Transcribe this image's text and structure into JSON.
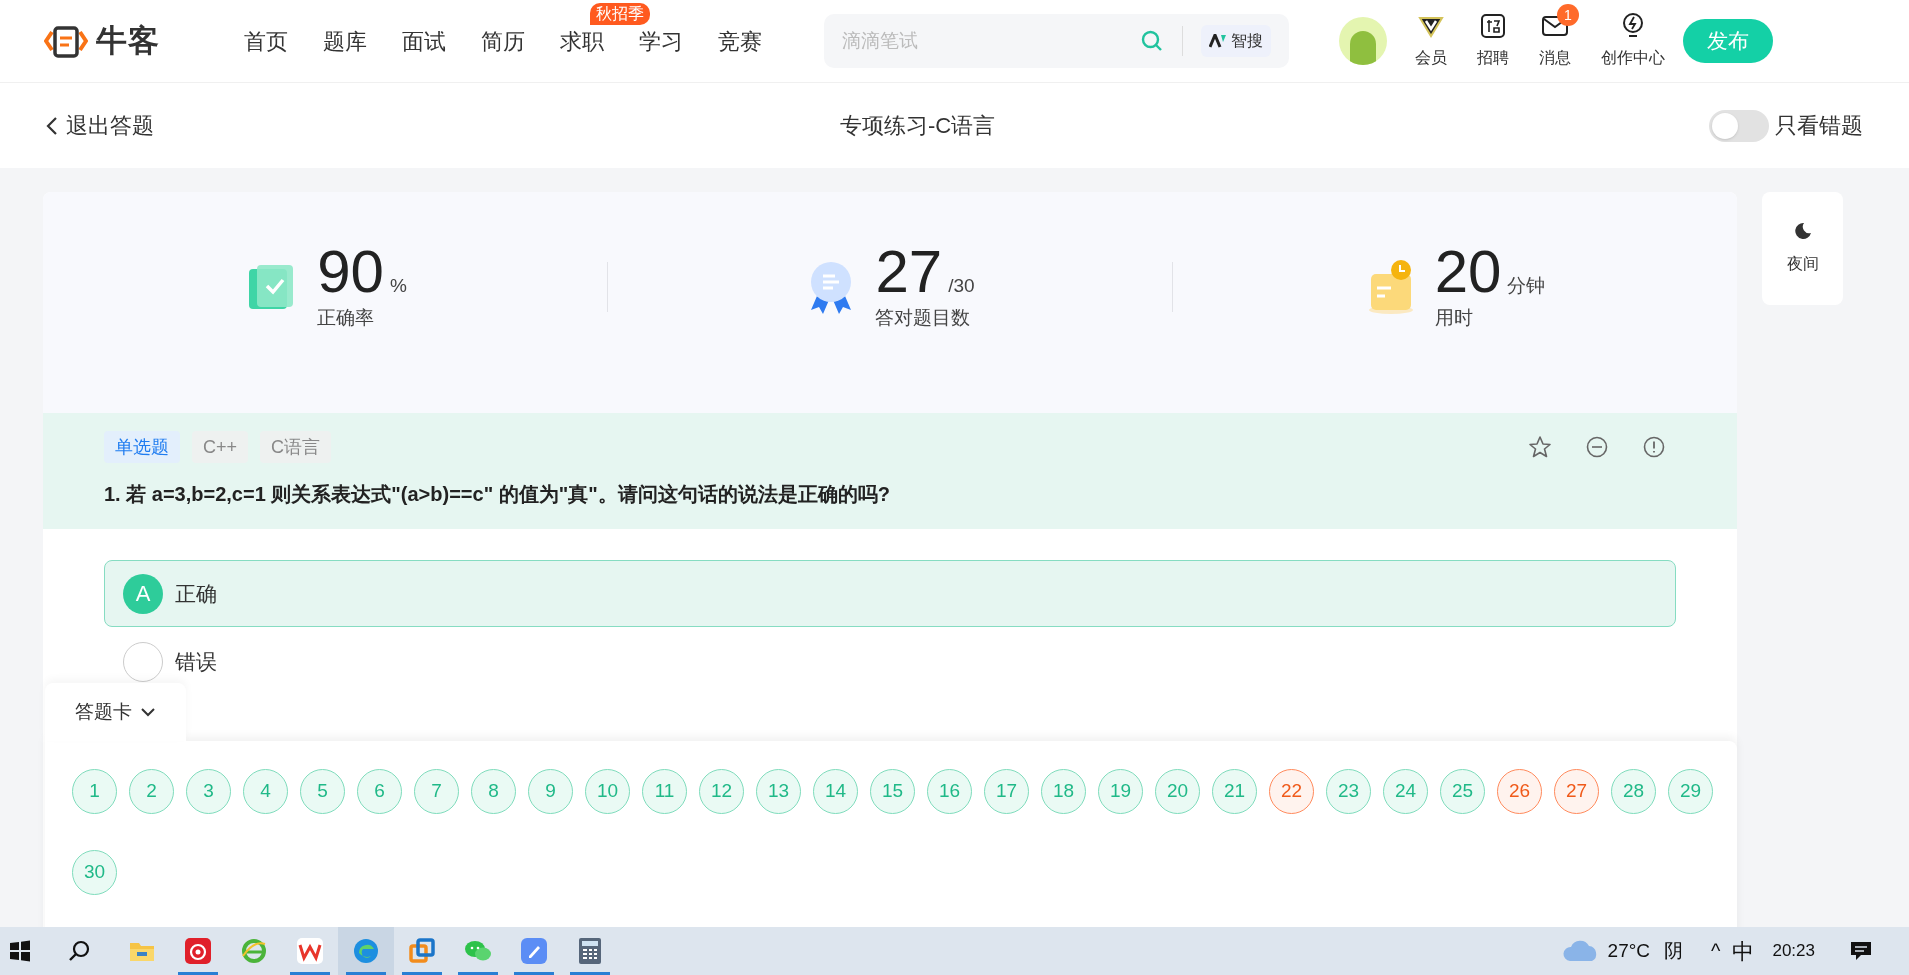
{
  "header": {
    "logo": "牛客",
    "nav": [
      {
        "label": "首页"
      },
      {
        "label": "题库"
      },
      {
        "label": "面试"
      },
      {
        "label": "简历"
      },
      {
        "label": "求职",
        "badge": "秋招季"
      },
      {
        "label": "学习"
      },
      {
        "label": "竞赛"
      }
    ],
    "search": {
      "placeholder": "滴滴笔试",
      "ai_button": "智搜"
    },
    "actions": [
      {
        "kind": "vip",
        "label": "会员"
      },
      {
        "kind": "jobs",
        "label": "招聘"
      },
      {
        "kind": "mail",
        "label": "消息",
        "badge": "1"
      },
      {
        "kind": "bulb",
        "label": "创作中心"
      }
    ],
    "publish": "发布"
  },
  "subheader": {
    "back": "退出答题",
    "title": "专项练习-C语言",
    "toggle": {
      "label": "只看错题",
      "on": false
    }
  },
  "stats": [
    {
      "kind": "rate",
      "value": "90",
      "unit": "%",
      "label": "正确率"
    },
    {
      "kind": "count",
      "value": "27",
      "unit": "/30",
      "label": "答对题目数"
    },
    {
      "kind": "time",
      "value": "20",
      "unit": "分钟",
      "label": "用时"
    }
  ],
  "night_button": "夜间",
  "question": {
    "tags": [
      {
        "label": "单选题",
        "kind": "type"
      },
      {
        "label": "C++",
        "kind": "topic"
      },
      {
        "label": "C语言",
        "kind": "topic"
      }
    ],
    "text": "1. 若 a=3,b=2,c=1 则关系表达式\"(a>b)==c\" 的值为\"真\"。请问这句话的说法是正确的吗?",
    "options": [
      {
        "letter": "A",
        "text": "正确",
        "selected": true
      },
      {
        "text": "错误",
        "selected": false
      }
    ]
  },
  "answer_card": {
    "label": "答题卡",
    "expanded": true,
    "items": [
      {
        "n": "1",
        "correct": true
      },
      {
        "n": "2",
        "correct": true
      },
      {
        "n": "3",
        "correct": true
      },
      {
        "n": "4",
        "correct": true
      },
      {
        "n": "5",
        "correct": true
      },
      {
        "n": "6",
        "correct": true
      },
      {
        "n": "7",
        "correct": true
      },
      {
        "n": "8",
        "correct": true
      },
      {
        "n": "9",
        "correct": true
      },
      {
        "n": "10",
        "correct": true
      },
      {
        "n": "11",
        "correct": true
      },
      {
        "n": "12",
        "correct": true
      },
      {
        "n": "13",
        "correct": true
      },
      {
        "n": "14",
        "correct": true
      },
      {
        "n": "15",
        "correct": true
      },
      {
        "n": "16",
        "correct": true
      },
      {
        "n": "17",
        "correct": true
      },
      {
        "n": "18",
        "correct": true
      },
      {
        "n": "19",
        "correct": true
      },
      {
        "n": "20",
        "correct": true
      },
      {
        "n": "21",
        "correct": true
      },
      {
        "n": "22",
        "correct": false
      },
      {
        "n": "23",
        "correct": true
      },
      {
        "n": "24",
        "correct": true
      },
      {
        "n": "25",
        "correct": true
      },
      {
        "n": "26",
        "correct": false
      },
      {
        "n": "27",
        "correct": false
      },
      {
        "n": "28",
        "correct": true
      },
      {
        "n": "29",
        "correct": true
      },
      {
        "n": "30",
        "correct": true
      }
    ]
  },
  "taskbar": {
    "apps": [
      {
        "kind": "folder",
        "running": false
      },
      {
        "kind": "music",
        "running": true
      },
      {
        "kind": "ie",
        "running": false
      },
      {
        "kind": "wps",
        "running": true
      },
      {
        "kind": "edge",
        "running": true
      },
      {
        "kind": "box",
        "running": true
      },
      {
        "kind": "chat",
        "running": true
      },
      {
        "kind": "note",
        "running": true
      },
      {
        "kind": "calc",
        "running": true
      }
    ],
    "temperature": "27°C",
    "weather": "阴",
    "caret": "^",
    "ime": "中",
    "time": "20:23"
  }
}
